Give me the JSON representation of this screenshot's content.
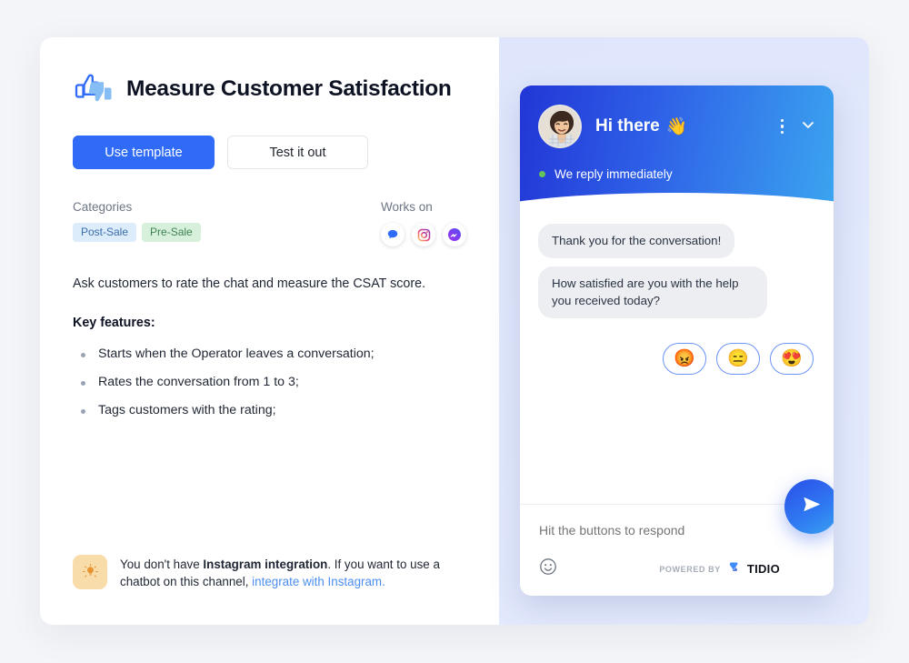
{
  "header": {
    "title": "Measure Customer Satisfaction",
    "icon": "thumbs-up-down-icon"
  },
  "actions": {
    "primary_label": "Use template",
    "secondary_label": "Test it out"
  },
  "meta": {
    "categories_label": "Categories",
    "categories": [
      {
        "label": "Post-Sale",
        "color": "#dcecfb",
        "text_color": "#3a6ea8"
      },
      {
        "label": "Pre-Sale",
        "color": "#d6f0dc",
        "text_color": "#3f8351"
      }
    ],
    "works_on_label": "Works on",
    "channels": [
      {
        "name": "live-chat-icon",
        "color": "#2f6bf6"
      },
      {
        "name": "instagram-icon",
        "color": "#d6249f"
      },
      {
        "name": "messenger-icon",
        "color": "#7b3ff2"
      }
    ]
  },
  "description": "Ask customers to rate the chat and measure the CSAT score.",
  "features_heading": "Key features:",
  "features": [
    "Starts when the Operator leaves a conversation;",
    "Rates the conversation from 1 to 3;",
    "Tags customers with the rating;"
  ],
  "notice": {
    "icon": "lightbulb-icon",
    "text_part1": "You don't have ",
    "text_bold": "Instagram integration",
    "text_part2": ". If you want to use a chatbot on this channel, ",
    "link_label": "integrate with Instagram.",
    "link_color": "#4c8ef0"
  },
  "widget": {
    "greeting": "Hi there",
    "greeting_emoji": "👋",
    "status": "We reply immediately",
    "status_dot_color": "#64c45a",
    "avatar": "operator-avatar",
    "menu_icon": "three-dots-menu-icon",
    "minimize_icon": "chevron-down-icon",
    "messages": [
      "Thank you for the conversation!",
      "How satisfied are you with the help you received today?"
    ],
    "ratings": [
      {
        "name": "rating-angry",
        "emoji": "😡"
      },
      {
        "name": "rating-neutral",
        "emoji": "😑"
      },
      {
        "name": "rating-love",
        "emoji": "😍"
      }
    ],
    "input_placeholder": "Hit the buttons to respond",
    "emoji_picker_icon": "smiley-face-icon",
    "powered_by_label": "POWERED BY",
    "powered_by_brand": "TIDIO",
    "send_icon": "send-paper-plane-icon"
  }
}
